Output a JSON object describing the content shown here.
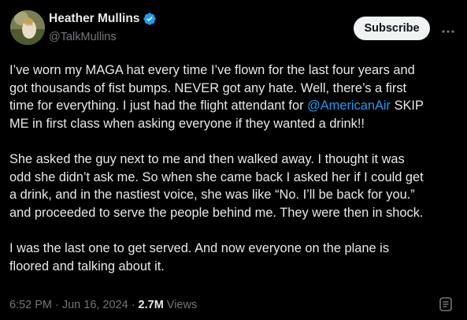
{
  "author": {
    "name": "Heather Mullins",
    "handle": "@TalkMullins",
    "verified": true,
    "avatar_icon": "avatar-photo"
  },
  "actions": {
    "subscribe_label": "Subscribe",
    "more_icon": "more-horizontal-icon"
  },
  "post": {
    "paragraph1_lines": [
      "I’ve worn my MAGA hat every time I’ve flown for the last four years and",
      "got thousands of fist bumps. NEVER got any hate. Well, there’s a first",
      "time for everything. I just had the flight attendant for "
    ],
    "mention": "@AmericanAir",
    "paragraph1_after_mention": " SKIP",
    "paragraph1_last_line": "ME in first class when asking everyone if they wanted a drink!!",
    "paragraph2_lines": [
      "She asked the guy next to me and then walked away. I thought it was",
      "odd she didn’t ask me. So when she came back I asked her if I could get",
      "a drink, and in the nastiest voice, she was like “No. I’ll be back for you.”",
      "and proceeded to serve the people behind me. They were then in shock."
    ],
    "paragraph3_lines": [
      "I was the last one to get served. And now everyone on the plane is",
      "floored and talking about it."
    ]
  },
  "meta": {
    "time": "6:52 PM",
    "separator": "·",
    "date": "Jun 16, 2024",
    "views_count": "2.7M",
    "views_label": "Views"
  },
  "colors": {
    "background": "#000000",
    "text": "#e7e9ea",
    "secondary_text": "#71767b",
    "link": "#1d9bf0",
    "verified_badge": "#1d9bf0",
    "subscribe_bg": "#eff3f4"
  }
}
